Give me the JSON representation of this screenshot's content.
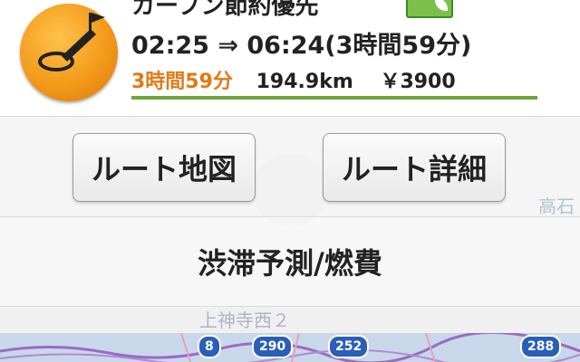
{
  "route": {
    "title": "カーブン節約優先",
    "time_range": "02:25 ⇒ 06:24(3時間59分)",
    "duration": "3時間59分",
    "distance": "194.9km",
    "fee": "￥3900"
  },
  "buttons": {
    "route_map": "ルート地図",
    "route_detail": "ルート詳細"
  },
  "congestion": {
    "label": "渋滞予測/燃費"
  },
  "map": {
    "label_bottom": "上神寺西２",
    "label_right": "高石",
    "shields": [
      "8",
      "290",
      "252",
      "288"
    ]
  },
  "colors": {
    "icon_orange": "#f39a1b",
    "duration_orange": "#e07a16",
    "underline_green": "#6aa83a",
    "eco_green": "#7cc04a"
  },
  "icons": {
    "route_icon": "car-flag-icon",
    "eco_badge": "eco-leaf-icon"
  }
}
